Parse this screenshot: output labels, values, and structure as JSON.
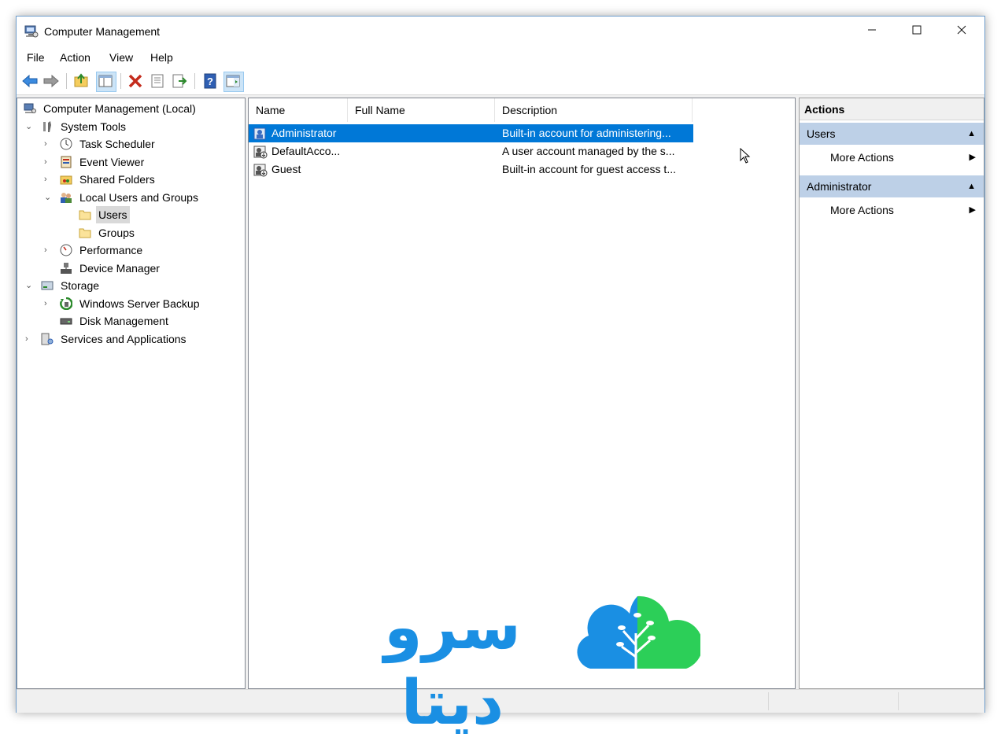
{
  "window": {
    "title": "Computer Management"
  },
  "menu": [
    "File",
    "Action",
    "View",
    "Help"
  ],
  "toolbar": {
    "buttons": [
      "back-arrow-icon",
      "forward-arrow-icon",
      "up-folder-icon",
      "show-hide-tree-icon",
      "delete-icon",
      "properties-icon",
      "export-list-icon",
      "help-icon",
      "show-hide-action-pane-icon"
    ]
  },
  "tree": {
    "root": "Computer Management (Local)",
    "system_tools": "System Tools",
    "task_scheduler": "Task Scheduler",
    "event_viewer": "Event Viewer",
    "shared_folders": "Shared Folders",
    "local_users_groups": "Local Users and Groups",
    "users": "Users",
    "groups": "Groups",
    "performance": "Performance",
    "device_manager": "Device Manager",
    "storage": "Storage",
    "windows_server_backup": "Windows Server Backup",
    "disk_management": "Disk Management",
    "services_apps": "Services and Applications"
  },
  "list": {
    "columns": [
      "Name",
      "Full Name",
      "Description"
    ],
    "rows": [
      {
        "name": "Administrator",
        "full_name": "",
        "description": "Built-in account for administering..."
      },
      {
        "name": "DefaultAcco...",
        "full_name": "",
        "description": "A user account managed by the s..."
      },
      {
        "name": "Guest",
        "full_name": "",
        "description": "Built-in account for guest access t..."
      }
    ]
  },
  "actions": {
    "title": "Actions",
    "section1": "Users",
    "section1_item": "More Actions",
    "section2": "Administrator",
    "section2_item": "More Actions"
  },
  "watermark": {
    "text": "سرو دیتا",
    "colors": {
      "blue": "#1a8fe3",
      "green": "#2ccf58"
    }
  },
  "colors": {
    "selection": "#0078d7",
    "action_header": "#bdd0e7",
    "window_border": "#6e9ecd"
  }
}
